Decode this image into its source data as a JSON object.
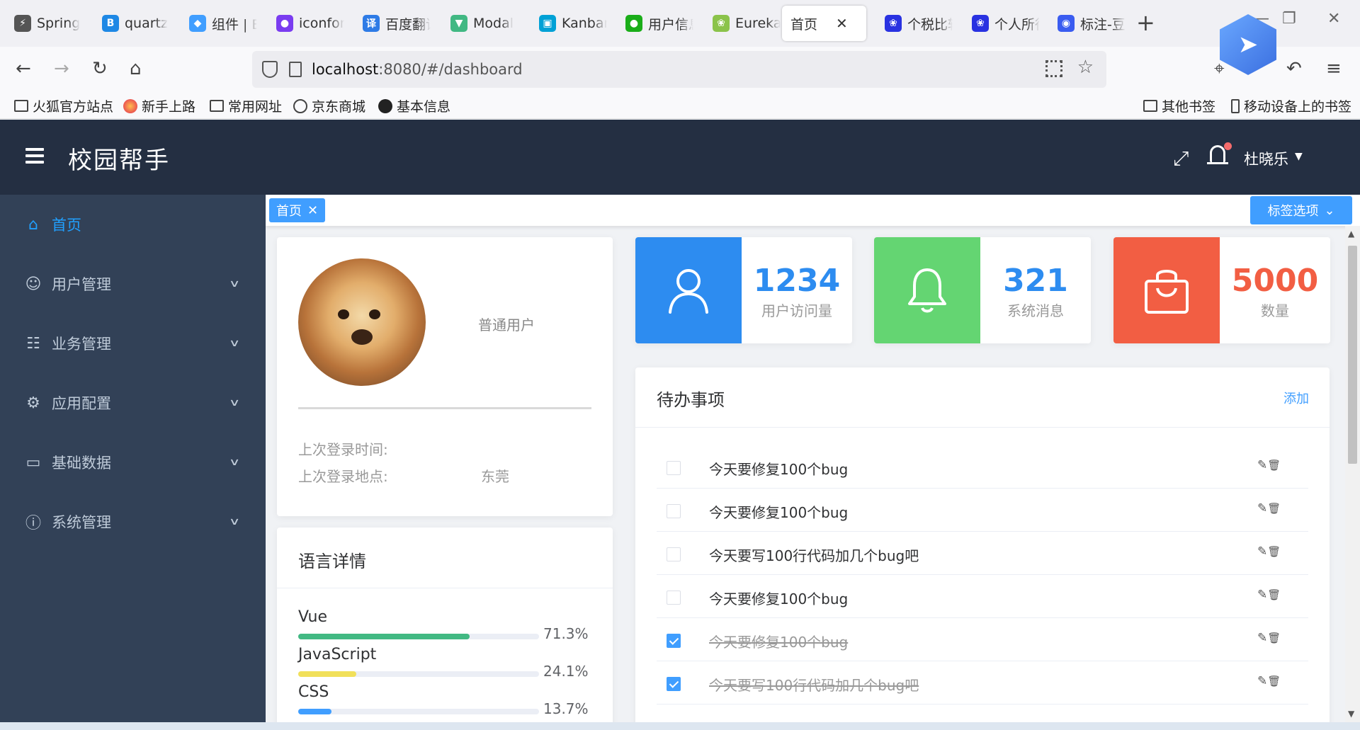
{
  "browser": {
    "tabs": [
      {
        "label": "Spring",
        "icon": "spring-icon",
        "color": "#555555",
        "glyph": "⚡"
      },
      {
        "label": "quartz",
        "icon": "b-icon",
        "color": "#1e88e5",
        "glyph": "B"
      },
      {
        "label": "组件 | E",
        "icon": "cube-icon",
        "color": "#409eff",
        "glyph": "◆"
      },
      {
        "label": "iconfon",
        "icon": "iconfont-icon",
        "color": "#7a3cf0",
        "glyph": "●"
      },
      {
        "label": "百度翻译",
        "icon": "translate-icon",
        "color": "#2e7be6",
        "glyph": "译"
      },
      {
        "label": "Modal",
        "icon": "bootstrap-vue-icon",
        "color": "#41b883",
        "glyph": "▼"
      },
      {
        "label": "Kanban",
        "icon": "bilibili-icon",
        "color": "#00a1d6",
        "glyph": "▣"
      },
      {
        "label": "用户信息",
        "icon": "wechat-icon",
        "color": "#1aad19",
        "glyph": "●"
      },
      {
        "label": "Eureka",
        "icon": "spring-leaf-icon",
        "color": "#8bc34a",
        "glyph": "❀"
      },
      {
        "label": "首页",
        "icon": "",
        "color": "",
        "glyph": "",
        "active": true
      },
      {
        "label": "个税比较",
        "icon": "baidu-paw-icon",
        "color": "#2932e1",
        "glyph": "❀"
      },
      {
        "label": "个人所得",
        "icon": "baidu-paw-icon",
        "color": "#2932e1",
        "glyph": "❀"
      },
      {
        "label": "标注-豆",
        "icon": "label-icon",
        "color": "#3a5cf0",
        "glyph": "◉"
      }
    ],
    "url_host": "localhost",
    "url_rest": ":8080/#/dashboard",
    "bookmarks": [
      {
        "label": "火狐官方站点",
        "icon": "folder-icon"
      },
      {
        "label": "新手上路",
        "icon": "firefox-icon"
      },
      {
        "label": "常用网址",
        "icon": "folder-icon"
      },
      {
        "label": "京东商城",
        "icon": "globe-icon"
      },
      {
        "label": "基本信息",
        "icon": "angular-icon"
      }
    ],
    "bookmarks_right": [
      {
        "label": "其他书签",
        "icon": "folder-icon"
      },
      {
        "label": "移动设备上的书签",
        "icon": "mobile-icon"
      }
    ]
  },
  "header": {
    "title": "校园帮手",
    "user": "杜晓乐"
  },
  "sidebar": {
    "items": [
      {
        "label": "首页",
        "icon": "home-icon",
        "glyph": "⌂",
        "active": true,
        "has_children": false
      },
      {
        "label": "用户管理",
        "icon": "user-icon",
        "glyph": "☺",
        "has_children": true
      },
      {
        "label": "业务管理",
        "icon": "grid-icon",
        "glyph": "☷",
        "has_children": true
      },
      {
        "label": "应用配置",
        "icon": "gear-icon",
        "glyph": "⚙",
        "has_children": true
      },
      {
        "label": "基础数据",
        "icon": "monitor-icon",
        "glyph": "▭",
        "has_children": true
      },
      {
        "label": "系统管理",
        "icon": "info-circle-icon",
        "glyph": "ⓘ",
        "has_children": true
      }
    ]
  },
  "tagbar": {
    "tag": "首页",
    "options": "标签选项"
  },
  "profile": {
    "role": "普通用户",
    "last_login_time_label": "上次登录时间:",
    "last_login_time": "",
    "last_login_place_label": "上次登录地点:",
    "last_login_place": "东莞"
  },
  "language": {
    "title": "语言详情",
    "items": [
      {
        "name": "Vue",
        "percent": 71.3,
        "percent_text": "71.3%",
        "color": "#42b983"
      },
      {
        "name": "JavaScript",
        "percent": 24.1,
        "percent_text": "24.1%",
        "color": "#f1e05a"
      },
      {
        "name": "CSS",
        "percent": 13.7,
        "percent_text": "13.7%",
        "color": "#409eff"
      }
    ]
  },
  "stats": [
    {
      "value": "1234",
      "label": "用户访问量",
      "icon": "user-icon",
      "bg": "#2d8cf0",
      "color": "#2d8cf0"
    },
    {
      "value": "321",
      "label": "系统消息",
      "icon": "bell-icon",
      "bg": "#64d572",
      "color": "#2d8cf0"
    },
    {
      "value": "5000",
      "label": "数量",
      "icon": "shopping-bag-icon",
      "bg": "#f25e43",
      "color": "#f25e43"
    }
  ],
  "todo": {
    "title": "待办事项",
    "add": "添加",
    "items": [
      {
        "text": "今天要修复100个bug",
        "done": false
      },
      {
        "text": "今天要修复100个bug",
        "done": false
      },
      {
        "text": "今天要写100行代码加几个bug吧",
        "done": false
      },
      {
        "text": "今天要修复100个bug",
        "done": false
      },
      {
        "text": "今天要修复100个bug",
        "done": true
      },
      {
        "text": "今天要写100行代码加几个bug吧",
        "done": true
      }
    ]
  }
}
